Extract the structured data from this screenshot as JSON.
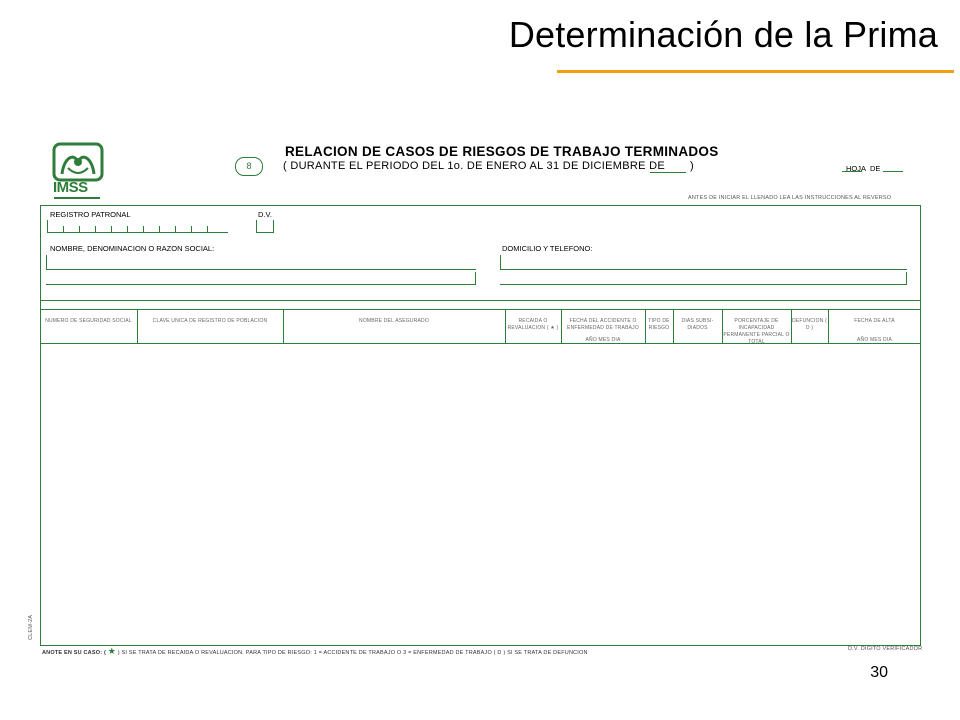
{
  "slide": {
    "title": "Determinación de la Prima",
    "page_number": "30",
    "accent_color": "#f0a10e"
  },
  "logo": {
    "name": "imss-logo-icon",
    "text": "IMSS",
    "color": "#2f7d3a"
  },
  "form": {
    "title": "RELACION DE CASOS DE RIESGOS DE TRABAJO TERMINADOS",
    "number": "8",
    "period": "( DURANTE EL PERIODO DEL 1o. DE ENERO AL 31 DE DICIEMBRE DE",
    "period_close": ")",
    "sheet_label": "HOJA",
    "of_label": "DE",
    "instructions": "ANTES DE INICIAR EL LLENADO LEA LAS INSTRUCCIONES AL REVERSO",
    "fields": {
      "registro_patronal": "REGISTRO PATRONAL",
      "dv": "D.V.",
      "nombre": "NOMBRE, DENOMINACION O RAZON SOCIAL:",
      "domicilio": "DOMICILIO Y TELEFONO:"
    },
    "columns": [
      {
        "key": "nss",
        "label": "NUMERO DE SEGURIDAD SOCIAL"
      },
      {
        "key": "curp",
        "label": "CLAVE UNICA DE REGISTRO DE POBLACION"
      },
      {
        "key": "nombre",
        "label": "NOMBRE DEL ASEGURADO"
      },
      {
        "key": "recaida",
        "label": "RECAIDA O REVALUACION ( ★ )"
      },
      {
        "key": "fecha_accidente",
        "label": "FECHA DEL ACCIDENTE O ENFERMEDAD DE TRABAJO",
        "sub": "AÑO   MES   DIA"
      },
      {
        "key": "tipo",
        "label": "TIPO DE RIESGO"
      },
      {
        "key": "dias",
        "label": "DIAS SUBSI- DIADOS"
      },
      {
        "key": "porcentaje",
        "label": "PORCENTAJE DE INCAPACIDAD PERMANENTE PARCIAL O TOTAL"
      },
      {
        "key": "defuncion",
        "label": "DEFUNCION ( D )"
      },
      {
        "key": "fecha_alta",
        "label": "FECHA DE ALTA",
        "sub": "AÑO   MES   DIA"
      }
    ],
    "footer_note": "ANOTE EN SU CASO: (",
    "footer_star": "★",
    "footer_text": ") SI SE TRATA DE RECAIDA O REVALUACION. PARA TIPO DE RIESGO: 1 = ACCIDENTE DE TRABAJO O 3 = ENFERMEDAD DE TRABAJO ( D ) SI SE TRATA DE DEFUNCION",
    "footer_right": "D.V. DIGITO VERIFICADOR",
    "side_code": "CLEM-2A"
  }
}
